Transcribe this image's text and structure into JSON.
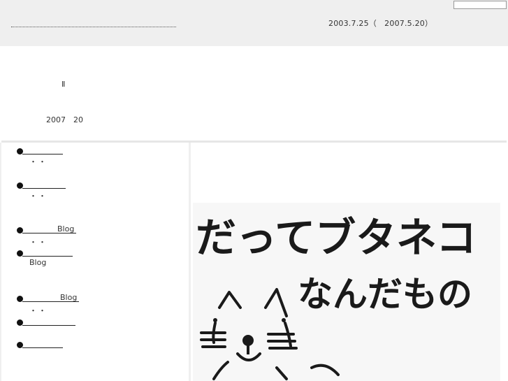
{
  "header": {
    "date_range": "2003.7.25（　2007.5.20）"
  },
  "intro": {
    "mark": "Ⅱ",
    "date": "2007　20"
  },
  "nav": {
    "items": [
      {
        "label": "",
        "sub": "・・"
      },
      {
        "label": "",
        "sub": "・・"
      },
      {
        "label": "Blog",
        "sub": "・・"
      },
      {
        "label": "",
        "sub": "Blog"
      },
      {
        "label": "Blog",
        "sub": "・・"
      },
      {
        "label": "",
        "sub": ""
      },
      {
        "label": "",
        "sub": ""
      }
    ]
  },
  "main": {
    "image_text_line1": "だってブタネコ",
    "image_text_line2": "なんだもの"
  }
}
